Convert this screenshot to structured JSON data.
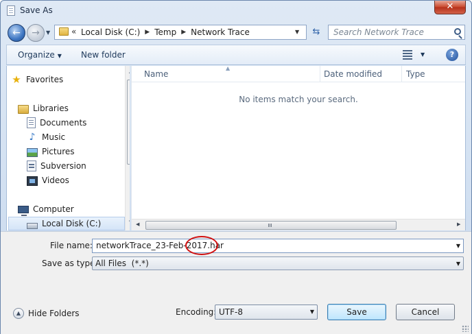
{
  "window": {
    "title": "Save As",
    "close_label": "✕"
  },
  "address": {
    "chevron": "«",
    "crumbs": [
      "Local Disk (C:)",
      "Temp",
      "Network Trace"
    ],
    "search_placeholder": "Search Network Trace"
  },
  "toolbar": {
    "organize": "Organize",
    "new_folder": "New folder",
    "help": "?"
  },
  "nav": {
    "items": [
      {
        "label": "Favorites",
        "icon": "star-icon"
      },
      {
        "label": "Libraries",
        "icon": "library-icon"
      },
      {
        "label": "Documents",
        "icon": "documents-icon"
      },
      {
        "label": "Music",
        "icon": "music-icon"
      },
      {
        "label": "Pictures",
        "icon": "pictures-icon"
      },
      {
        "label": "Subversion",
        "icon": "subversion-icon"
      },
      {
        "label": "Videos",
        "icon": "videos-icon"
      },
      {
        "label": "Computer",
        "icon": "computer-icon"
      },
      {
        "label": "Local Disk (C:)",
        "icon": "disk-icon",
        "selected": true
      }
    ]
  },
  "files": {
    "columns": [
      "Name",
      "Date modified",
      "Type"
    ],
    "empty_message": "No items match your search."
  },
  "form": {
    "file_name_label": "File name:",
    "file_name_value": "networkTrace_23-Feb-2017.har",
    "save_type_label": "Save as type:",
    "save_type_value": "All Files  (*.*)",
    "encoding_label": "Encoding:",
    "encoding_value": "UTF-8",
    "hide_folders": "Hide Folders",
    "save_button": "Save",
    "cancel_button": "Cancel"
  },
  "colors": {
    "annotation": "#d10f0f",
    "accent": "#3c7fb1"
  }
}
